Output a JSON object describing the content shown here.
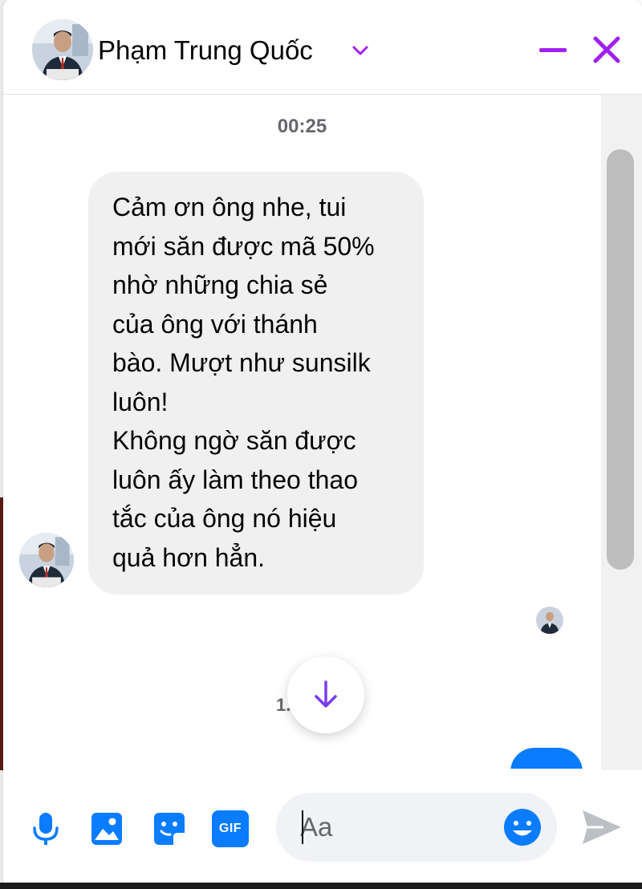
{
  "header": {
    "contact_name": "Phạm Trung Quốc",
    "icons": [
      "avatar",
      "chevron-down-icon",
      "minimize-icon",
      "close-icon"
    ],
    "accent_color": "#a020f0"
  },
  "messages": {
    "timestamp": "00:25",
    "incoming": {
      "lines": [
        "Cảm ơn ông nhe, tui",
        "mới săn được mã 50%",
        "nhờ những chia sẻ",
        "của ông với thánh",
        "bào. Mượt như sunsilk",
        "luôn!",
        "Không ngờ săn được",
        "luôn ấy làm theo thao",
        "tắc của ông nó hiệu",
        "quả hơn hẳn."
      ]
    },
    "partial_timestamp": "1.",
    "outgoing_color": "#0a7cff"
  },
  "composer": {
    "placeholder": "Aa",
    "tools": [
      "microphone-icon",
      "image-icon",
      "sticker-icon",
      "gif-icon"
    ],
    "gif_label": "GIF",
    "tool_color": "#0a7cff"
  }
}
